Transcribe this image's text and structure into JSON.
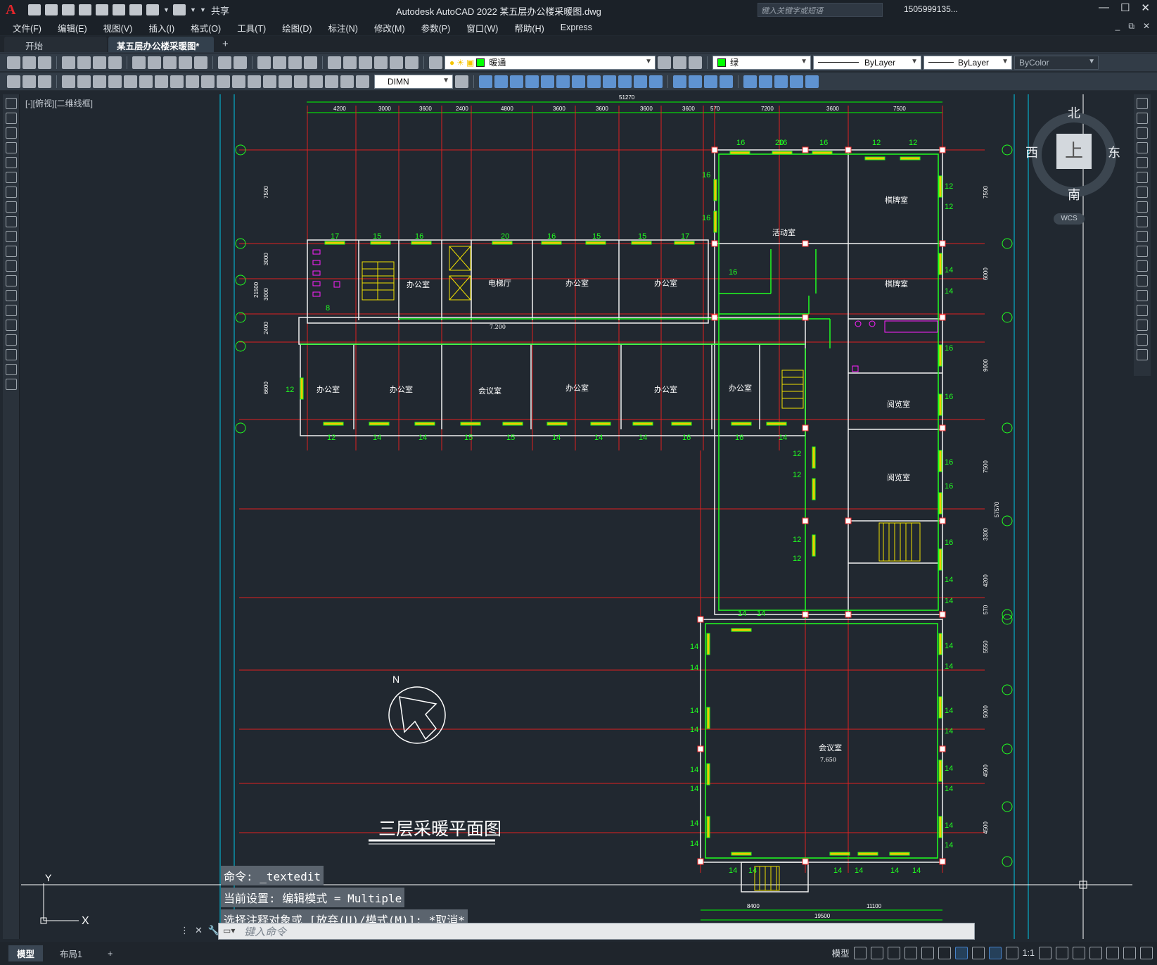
{
  "titlebar": {
    "logo": "A",
    "share": "共享",
    "title": "Autodesk AutoCAD 2022    某五层办公楼采暖图.dwg",
    "search_placeholder": "键入关键字或短语",
    "user": "1505999135...",
    "window_buttons": [
      "—",
      "☐",
      "✕"
    ]
  },
  "menubar": {
    "items": [
      "文件(F)",
      "编辑(E)",
      "视图(V)",
      "插入(I)",
      "格式(O)",
      "工具(T)",
      "绘图(D)",
      "标注(N)",
      "修改(M)",
      "参数(P)",
      "窗口(W)",
      "帮助(H)",
      "Express"
    ],
    "mdi_buttons": [
      "_",
      "⧉",
      "✕"
    ]
  },
  "tabs": {
    "start": "开始",
    "active": "某五层办公楼采暖图*",
    "close": "✕",
    "add": "+"
  },
  "ribbon": {
    "layer": "暖通",
    "color": "绿",
    "linetype": "ByLayer",
    "lineweight": "ByLayer",
    "plotstyle": "ByColor",
    "dimstyle": "DIMN"
  },
  "viewport_label": "[-][俯视][二维线框]",
  "viewcube": {
    "north": "北",
    "south": "南",
    "east": "东",
    "west": "西",
    "face": "上",
    "wcs": "WCS"
  },
  "drawing": {
    "title": "三层采暖平面图",
    "north_label": "N",
    "room_labels": {
      "office": "办公室",
      "elevator_hall": "电梯厅",
      "meeting": "会议室",
      "activity": "活动室",
      "chess": "棋牌室",
      "reading": "阅览室",
      "big_meeting": "会议室"
    },
    "top_dims": [
      "4200",
      "3000",
      "3600",
      "2400",
      "4800",
      "3600",
      "3600",
      "3600",
      "3600",
      "570",
      "7200",
      "3600",
      "7500"
    ],
    "top_total": "51270",
    "right_dims": [
      "7500",
      "6000",
      "9000",
      "7500",
      "3300",
      "4200",
      "570",
      "5550",
      "5000",
      "4500",
      "4500"
    ],
    "right_total": "57570",
    "left_dims": [
      "7500",
      "3000",
      "3000",
      "2400",
      "6600"
    ],
    "left_total": "21500",
    "bottom_dims": [
      "8400",
      "11100"
    ],
    "bottom_total": "19500",
    "elevations": [
      "7.200",
      "7.650"
    ],
    "rad_top_row1": [
      "16",
      "16",
      "16",
      "12",
      "12"
    ],
    "rad_top_row2": [
      "17",
      "15",
      "16",
      "20",
      "16",
      "15",
      "15",
      "17"
    ],
    "rad_bottom_row": [
      "12",
      "14",
      "14",
      "15",
      "15",
      "14",
      "14",
      "14",
      "16",
      "16",
      "14"
    ],
    "rad_right_col": [
      "12",
      "12",
      "14",
      "14",
      "16",
      "16",
      "16",
      "16",
      "16",
      "14",
      "14",
      "14",
      "14",
      "14",
      "14",
      "14",
      "14",
      "14",
      "14"
    ],
    "rad_left_col": [
      "14",
      "14",
      "14",
      "14",
      "14",
      "14",
      "14",
      "14"
    ],
    "rad_mid_col": [
      "12",
      "12",
      "12",
      "12"
    ],
    "rad_misc": [
      "16",
      "16",
      "16",
      "20",
      "12",
      "8",
      "14",
      "14",
      "14",
      "14",
      "14",
      "14",
      "14",
      "14"
    ]
  },
  "command": {
    "history": [
      "命令: _textedit",
      "当前设置: 编辑模式 = Multiple",
      "选择注释对象或 [放弃(U)/模式(M)]: *取消*"
    ],
    "placeholder": "键入命令"
  },
  "statusbar": {
    "layouts": [
      "模型",
      "布局1",
      "+"
    ],
    "model": "模型",
    "scale": "1:1"
  }
}
